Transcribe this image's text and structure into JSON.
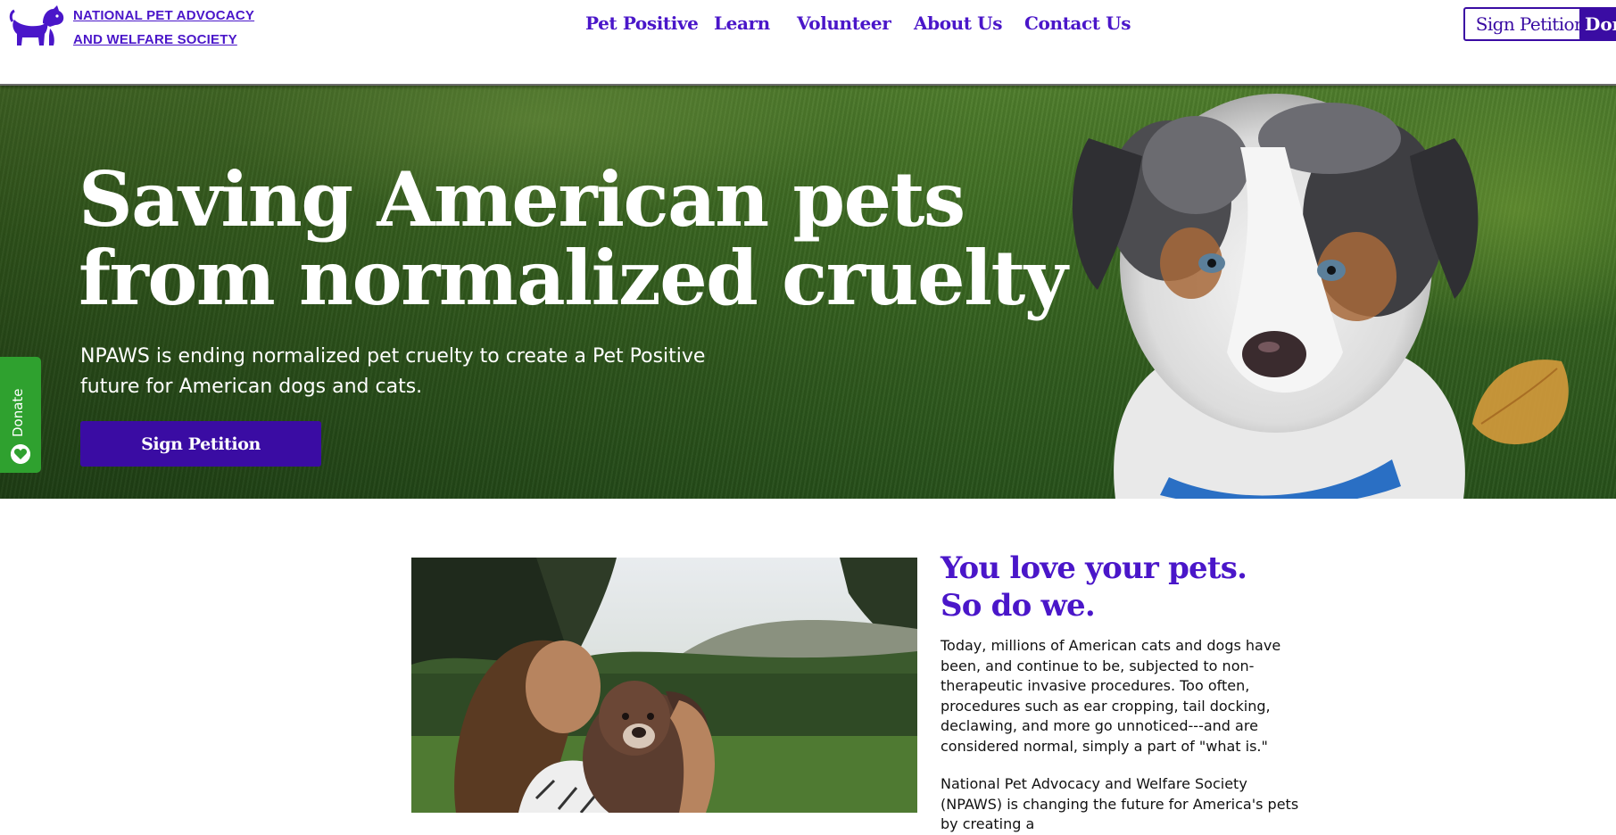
{
  "header": {
    "logo_line1": "NATIONAL PET ADVOCACY",
    "logo_line2": "AND WELFARE SOCIETY",
    "nav": [
      {
        "label": "Pet Positive"
      },
      {
        "label": "Learn"
      },
      {
        "label": "Volunteer"
      },
      {
        "label": "About Us"
      },
      {
        "label": "Contact Us"
      }
    ],
    "sign_petition_label": "Sign Petition",
    "donate_label": "Donate"
  },
  "hero": {
    "title_line1": "Saving American pets",
    "title_line2": "from normalized cruelty",
    "subtitle": "NPAWS is ending normalized pet cruelty to create a Pet Positive future for American dogs and cats.",
    "button_label": "Sign Petition"
  },
  "side_tab": {
    "label": "Donate",
    "color": "#2fa12f"
  },
  "intro": {
    "heading_line1": "You love your pets.",
    "heading_line2": "So do we.",
    "paragraph1": "Today, millions of American cats and dogs have been, and continue to be, subjected to non-therapeutic invasive procedures. Too often, procedures such as ear cropping, tail docking, declawing, and more go unnoticed---and are considered normal, simply a part of \"what is.\"",
    "paragraph2": "National Pet Advocacy and Welfare Society (NPAWS) is changing the future for America's pets by creating a"
  },
  "colors": {
    "brand_purple": "#4a16c9",
    "button_purple": "#3a0ca3",
    "hero_text": "#ffffff"
  },
  "icons": {
    "logo": "dog-cat-silhouette-icon",
    "side_tab": "heart-icon"
  }
}
